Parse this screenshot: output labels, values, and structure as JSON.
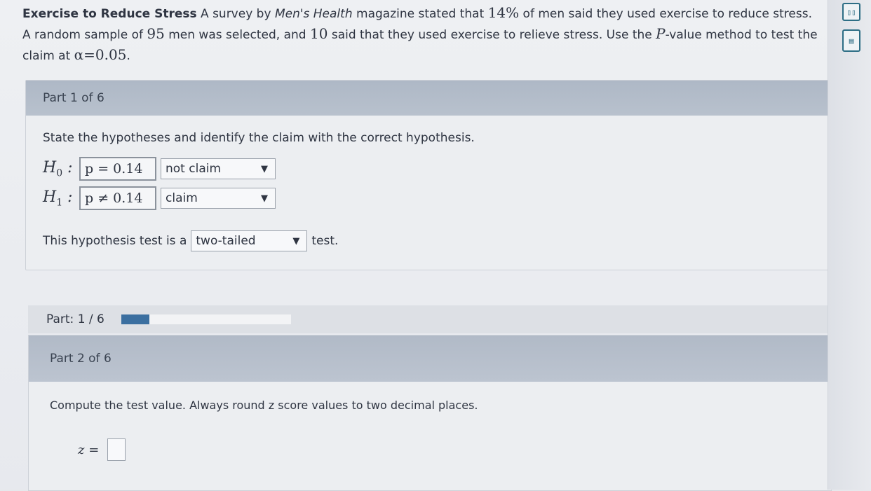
{
  "problem": {
    "title": "Exercise to Reduce Stress",
    "text1": "A survey by",
    "magazine": "Men's Health",
    "text2": "magazine stated that",
    "pct": "14%",
    "text3": "of men said they used exercise to reduce stress. A random sample of",
    "n": "95",
    "text4": "men was selected, and",
    "x": "10",
    "text5": "said that they used exercise to relieve stress. Use the",
    "pvalue": "P",
    "text6": "-value method to test the claim at",
    "alpha": "α=0.05",
    "text7": "."
  },
  "part1": {
    "header": "Part 1 of 6",
    "instruction": "State the hypotheses and identify the claim with the correct hypothesis.",
    "h0": {
      "label": "H",
      "sub": "0",
      "value": "p = 0.14",
      "claim": "not claim"
    },
    "h1": {
      "label": "H",
      "sub": "1",
      "value": "p ≠ 0.14",
      "claim": "claim"
    },
    "test_prefix": "This hypothesis test is a",
    "test_type": "two-tailed",
    "test_suffix": "test."
  },
  "progress": {
    "label": "Part: 1 / 6",
    "fraction": 0.1667
  },
  "part2": {
    "header": "Part 2 of 6",
    "instruction": "Compute the test value. Always round z score values to two decimal places.",
    "z_label": "z ="
  },
  "icons": [
    "calculator-icon",
    "table-icon"
  ]
}
